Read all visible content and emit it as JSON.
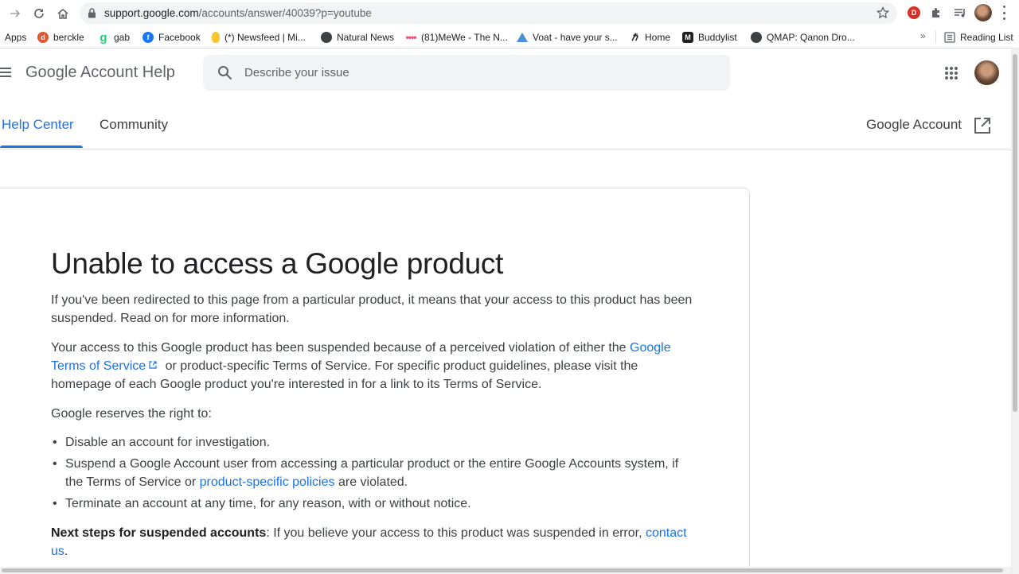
{
  "browser": {
    "url_host": "support.google.com",
    "url_path": "/accounts/answer/40039?p=youtube",
    "extension_badge": "D",
    "bookmarks": [
      {
        "label": "Apps",
        "icon": "apps-grid-icon"
      },
      {
        "label": "berckle",
        "icon": "duckduckgo-icon",
        "color": "#de5833"
      },
      {
        "label": "gab",
        "icon": "gab-icon",
        "color": "#21cf7a"
      },
      {
        "label": "Facebook",
        "icon": "facebook-icon",
        "color": "#1877f2"
      },
      {
        "label": "(*) Newsfeed | Mi...",
        "icon": "lightbulb-icon",
        "color": "#f9c531"
      },
      {
        "label": "Natural News",
        "icon": "globe-icon"
      },
      {
        "label": "(81)MeWe - The N...",
        "icon": "mewe-dots-icon"
      },
      {
        "label": "Voat - have your s...",
        "icon": "voat-icon",
        "color": "#4a90d9"
      },
      {
        "label": "Home",
        "icon": "home-glyph-icon"
      },
      {
        "label": "Buddylist",
        "icon": "buddylist-icon"
      },
      {
        "label": "QMAP: Qanon Dro...",
        "icon": "globe-icon"
      }
    ],
    "more_bookmarks": "»",
    "reading_list": "Reading List"
  },
  "header": {
    "product_name": "Google Account Help",
    "search_placeholder": "Describe your issue"
  },
  "tabs": {
    "items": [
      {
        "label": "Help Center",
        "active": true
      },
      {
        "label": "Community",
        "active": false
      }
    ],
    "account_link": "Google Account"
  },
  "article": {
    "title": "Unable to access a Google product",
    "intro": "If you've been redirected to this page from a particular product, it means that your access to this product has been suspended. Read on for more information.",
    "p2_before": "Your access to this Google product has been suspended because of a perceived violation of either the ",
    "p2_link": "Google Terms of Service",
    "p2_after": " or product-specific Terms of Service. For specific product guidelines, please visit the homepage of each Google product you're interested in for a link to its Terms of Service.",
    "reserves": "Google reserves the right to:",
    "bullet1": "Disable an account for investigation.",
    "bullet2_before": "Suspend a Google Account user from accessing a particular product or the entire Google Accounts system, if the Terms of Service or ",
    "bullet2_link": "product-specific policies",
    "bullet2_after": " are violated.",
    "bullet3": "Terminate an account at any time, for any reason, with or without notice.",
    "next_steps_label": "Next steps for suspended accounts",
    "next_steps_text": ": If you believe your access to this product was suspended in error, ",
    "contact_link": "contact us",
    "contact_after": "."
  },
  "colors": {
    "link": "#1a73e8",
    "text": "#3c4043",
    "border": "#dadce0"
  }
}
